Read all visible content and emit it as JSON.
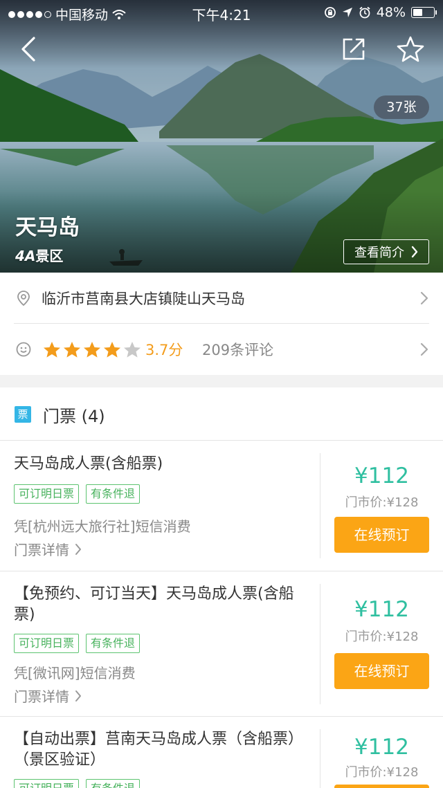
{
  "status_bar": {
    "carrier": "中国移动",
    "time": "下午4:21",
    "battery": "48%",
    "battery_fraction": 0.48
  },
  "hero": {
    "photo_count": "37张",
    "title": "天马岛",
    "level_grade": "4A",
    "level_suffix": "景区",
    "intro_button": "查看简介"
  },
  "info": {
    "address": "临沂市莒南县大店镇陡山天马岛",
    "rating": 3.7,
    "score_text": "3.7分",
    "reviews_text": "209条评论",
    "stars_filled": 4,
    "stars_total": 5
  },
  "tickets": {
    "badge": "票",
    "title": "门票 (4)",
    "items": [
      {
        "name": "天马岛成人票(含船票)",
        "tags": [
          "可订明日票",
          "有条件退"
        ],
        "vendor": "凭[杭州远大旅行社]短信消费",
        "detail": "门票详情",
        "price": "¥112",
        "orig_price": "门市价:¥128",
        "button": "在线预订"
      },
      {
        "name": "【免预约、可订当天】天马岛成人票(含船票)",
        "tags": [
          "可订明日票",
          "有条件退"
        ],
        "vendor": "凭[微讯网]短信消费",
        "detail": "门票详情",
        "price": "¥112",
        "orig_price": "门市价:¥128",
        "button": "在线预订"
      },
      {
        "name": "【自动出票】莒南天马岛成人票（含船票）（景区验证）",
        "tags": [
          "可订明日票",
          "有条件退"
        ],
        "price": "¥112",
        "orig_price": "门市价:¥128"
      }
    ]
  },
  "colors": {
    "price": "#2fbfa0",
    "book_button": "#fba515",
    "tag": "#5cc36f",
    "star": "#f39c1b",
    "ticket_badge": "#34b6e6"
  },
  "icons": [
    "back-icon",
    "share-icon",
    "star-outline-icon",
    "location-icon",
    "smiley-icon",
    "chevron-right-icon",
    "wifi-icon",
    "lock-rotation-icon",
    "location-arrow-icon",
    "alarm-icon",
    "battery-icon"
  ]
}
